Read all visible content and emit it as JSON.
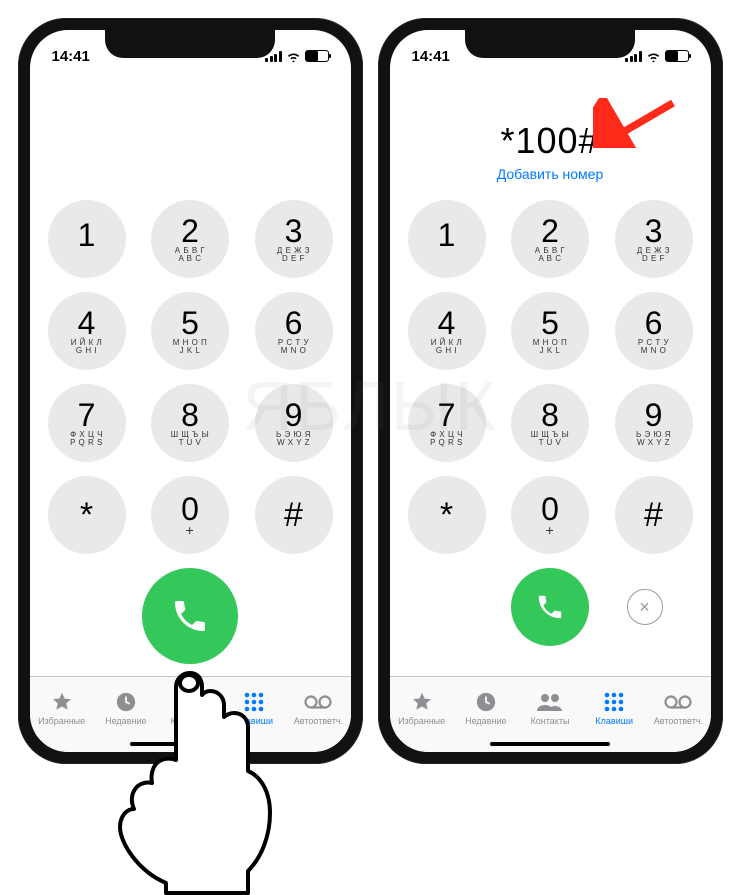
{
  "status": {
    "time": "14:41"
  },
  "phone_right": {
    "display_number": "*100#",
    "add_number_label": "Добавить номер"
  },
  "keypad": {
    "keys": [
      [
        {
          "digit": "1",
          "sub": " "
        },
        {
          "digit": "2",
          "sub": "А Б В Г\nA B C"
        },
        {
          "digit": "3",
          "sub": "Д Е Ж З\nD E F"
        }
      ],
      [
        {
          "digit": "4",
          "sub": "И Й К Л\nG H I"
        },
        {
          "digit": "5",
          "sub": "М Н О П\nJ K L"
        },
        {
          "digit": "6",
          "sub": "Р С Т У\nM N O"
        }
      ],
      [
        {
          "digit": "7",
          "sub": "Ф Х Ц Ч\nP Q R S"
        },
        {
          "digit": "8",
          "sub": "Ш Щ Ъ Ы\nT U V"
        },
        {
          "digit": "9",
          "sub": "Ь Э Ю Я\nW X Y Z"
        }
      ],
      [
        {
          "digit": "*",
          "sub": ""
        },
        {
          "digit": "0",
          "sub": "+"
        },
        {
          "digit": "#",
          "sub": ""
        }
      ]
    ]
  },
  "delete_symbol": "×",
  "tabs": {
    "favorites": "Избранные",
    "recents": "Недавние",
    "contacts": "Контакты",
    "keypad": "Клавиши",
    "voicemail": "Автоответч."
  },
  "watermark": "ЯБЛЫК"
}
